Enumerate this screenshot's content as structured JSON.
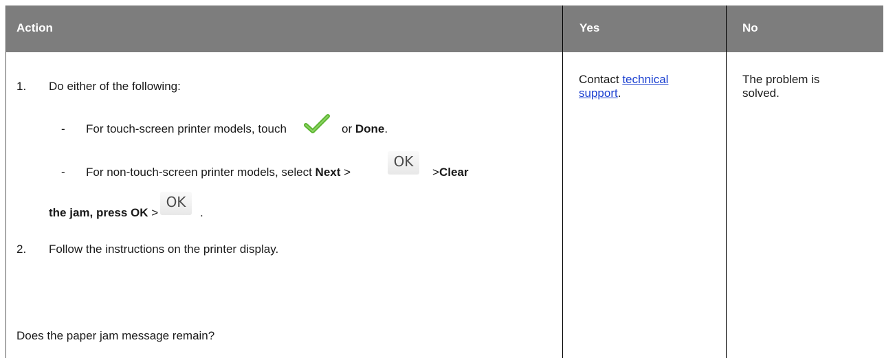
{
  "table": {
    "headers": {
      "action": "Action",
      "yes": "Yes",
      "no": "No"
    },
    "action": {
      "step1_number": "1.",
      "step1_text": "Do either of the following:",
      "touch_dash": "-",
      "touch_prefix": "For touch-screen printer models, touch",
      "touch_or": "or",
      "touch_done": "Done",
      "touch_end": ".",
      "nontouch_dash": "-",
      "nontouch_prefix": "For non-touch-screen printer models, select",
      "nontouch_next": "Next",
      "gt1": ">",
      "ok_label_1": "OK",
      "gt2": ">",
      "clear_bold_1": "Clear",
      "clear_bold_2": "the jam, press OK",
      "gt3": ">",
      "ok_label_2": "OK",
      "final_period": ".",
      "step2_number": "2.",
      "step2_text": "Follow the instructions on the printer display.",
      "question": "Does the paper jam message remain?"
    },
    "yes": {
      "contact": "Contact",
      "link_line1": "technical",
      "link_line2": "support",
      "period": "."
    },
    "no": {
      "line1": "The problem is",
      "line2": "solved."
    }
  },
  "icons": {
    "check": "checkmark-icon",
    "ok": "ok-button-icon"
  },
  "colors": {
    "header_bg": "#7d7d7d",
    "header_text": "#ffffff",
    "link": "#1a3fd0",
    "check": "#5cb531"
  }
}
